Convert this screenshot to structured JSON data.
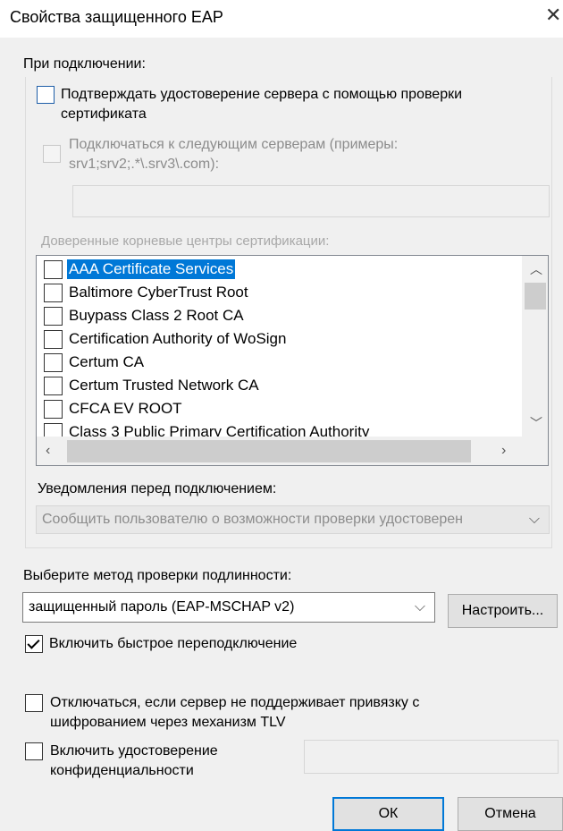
{
  "window": {
    "title": "Свойства защищенного EAP",
    "close_icon": "close-icon"
  },
  "connection": {
    "heading": "При подключении:",
    "verify_cert_line1": "Подтверждать удостоверение сервера с помощью проверки",
    "verify_cert_line2": "сертификата",
    "verify_cert_checked": false,
    "connect_servers_line1": "Подключаться к следующим серверам (примеры:",
    "connect_servers_line2": "srv1;srv2;.*\\.srv3\\.com):",
    "connect_servers_checked": false,
    "servers_value": "",
    "trusted_ca_label": "Доверенные корневые центры сертификации:"
  },
  "ca_list": [
    {
      "label": "AAA Certificate Services",
      "selected": true,
      "checked": false
    },
    {
      "label": "Baltimore CyberTrust Root",
      "selected": false,
      "checked": false
    },
    {
      "label": "Buypass Class 2 Root CA",
      "selected": false,
      "checked": false
    },
    {
      "label": "Certification Authority of WoSign",
      "selected": false,
      "checked": false
    },
    {
      "label": "Certum CA",
      "selected": false,
      "checked": false
    },
    {
      "label": "Certum Trusted Network CA",
      "selected": false,
      "checked": false
    },
    {
      "label": "CFCA EV ROOT",
      "selected": false,
      "checked": false
    },
    {
      "label": "Class 3 Public Primary Certification Authority",
      "selected": false,
      "checked": false
    }
  ],
  "notifications": {
    "label": "Уведомления перед подключением:",
    "value": "Сообщить пользователю о возможности проверки удостоверен"
  },
  "auth": {
    "label": "Выберите метод проверки подлинности:",
    "method": "защищенный пароль (EAP-MSCHAP v2)",
    "configure_button": "Настроить...",
    "fast_reconnect": "Включить быстрое переподключение",
    "fast_reconnect_checked": true,
    "disconnect_line1": "Отключаться, если сервер не поддерживает привязку с",
    "disconnect_line2": "шифрованием через механизм TLV",
    "disconnect_checked": false,
    "privacy_line1": "Включить удостоверение",
    "privacy_line2": "конфиденциальности",
    "privacy_checked": false,
    "privacy_value": ""
  },
  "footer": {
    "ok": "ОК",
    "cancel": "Отмена"
  }
}
